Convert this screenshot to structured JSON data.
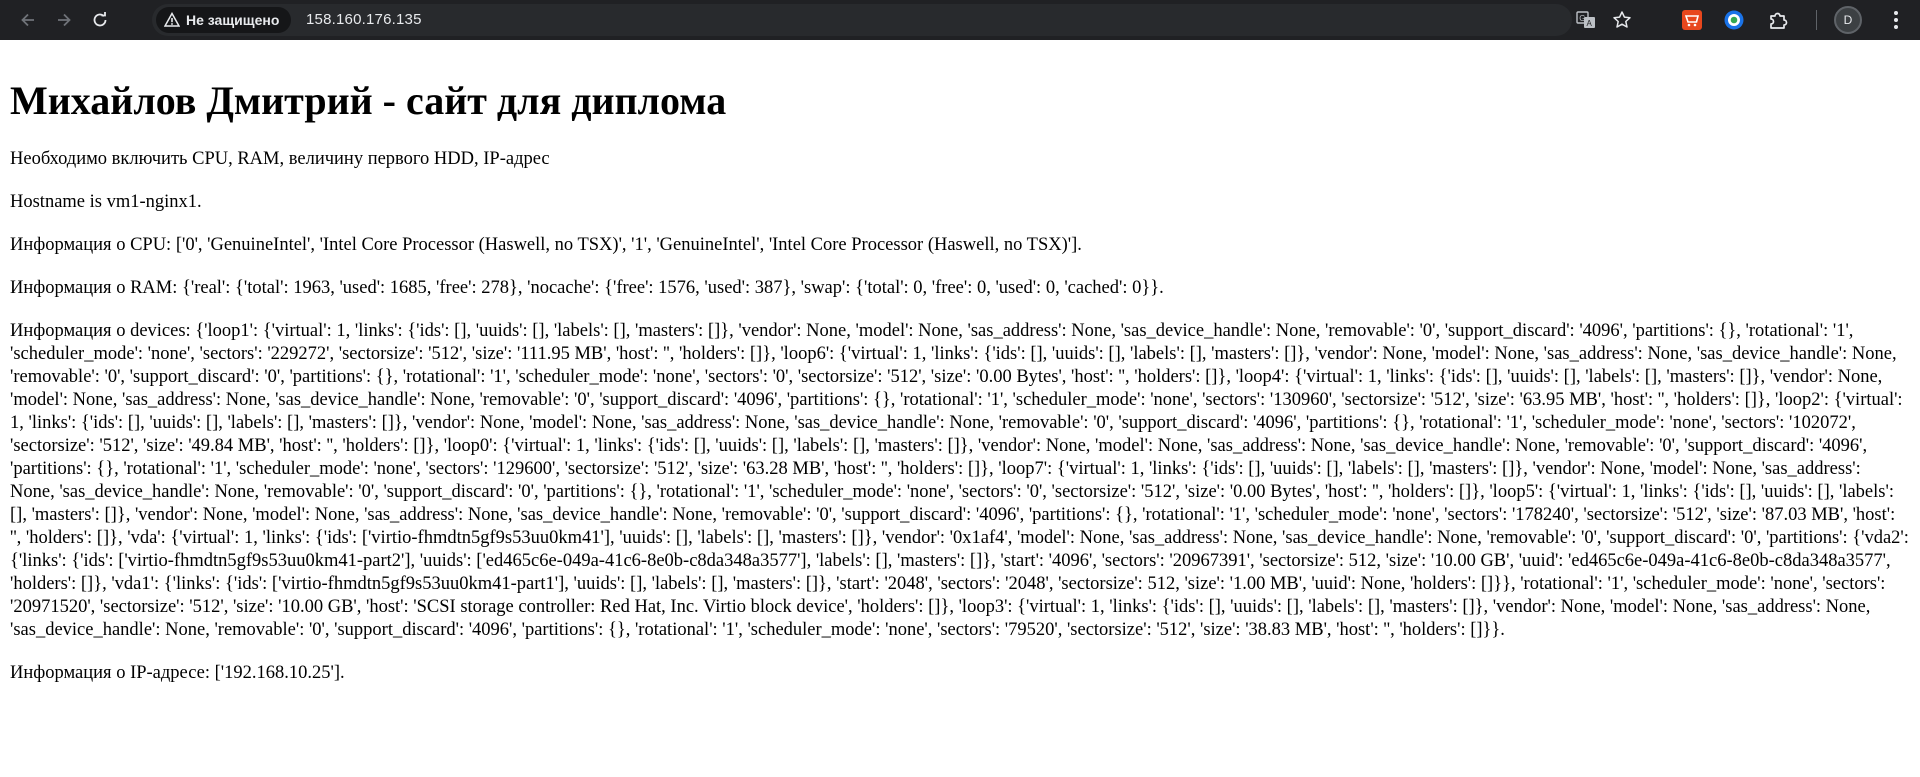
{
  "browser": {
    "security_label": "Не защищено",
    "url": "158.160.176.135",
    "profile_initial": "D",
    "icons": [
      "back-icon",
      "forward-icon",
      "reload-icon",
      "warning-icon",
      "translate-icon",
      "star-icon",
      "extension-icon",
      "puzzle-icon",
      "menu-icon"
    ]
  },
  "page": {
    "title": "Михайлов Дмитрий - сайт для диплома",
    "intro": "Необходимо включить CPU, RAM, величину первого HDD, IP-адрес",
    "hostname": "Hostname is vm1-nginx1.",
    "cpu": "Информация о CPU: ['0', 'GenuineIntel', 'Intel Core Processor (Haswell, no TSX)', '1', 'GenuineIntel', 'Intel Core Processor (Haswell, no TSX)'].",
    "ram": "Информация о RAM: {'real': {'total': 1963, 'used': 1685, 'free': 278}, 'nocache': {'free': 1576, 'used': 387}, 'swap': {'total': 0, 'free': 0, 'used': 0, 'cached': 0}}.",
    "devices": "Информация о devices: {'loop1': {'virtual': 1, 'links': {'ids': [], 'uuids': [], 'labels': [], 'masters': []}, 'vendor': None, 'model': None, 'sas_address': None, 'sas_device_handle': None, 'removable': '0', 'support_discard': '4096', 'partitions': {}, 'rotational': '1', 'scheduler_mode': 'none', 'sectors': '229272', 'sectorsize': '512', 'size': '111.95 MB', 'host': '', 'holders': []}, 'loop6': {'virtual': 1, 'links': {'ids': [], 'uuids': [], 'labels': [], 'masters': []}, 'vendor': None, 'model': None, 'sas_address': None, 'sas_device_handle': None, 'removable': '0', 'support_discard': '0', 'partitions': {}, 'rotational': '1', 'scheduler_mode': 'none', 'sectors': '0', 'sectorsize': '512', 'size': '0.00 Bytes', 'host': '', 'holders': []}, 'loop4': {'virtual': 1, 'links': {'ids': [], 'uuids': [], 'labels': [], 'masters': []}, 'vendor': None, 'model': None, 'sas_address': None, 'sas_device_handle': None, 'removable': '0', 'support_discard': '4096', 'partitions': {}, 'rotational': '1', 'scheduler_mode': 'none', 'sectors': '130960', 'sectorsize': '512', 'size': '63.95 MB', 'host': '', 'holders': []}, 'loop2': {'virtual': 1, 'links': {'ids': [], 'uuids': [], 'labels': [], 'masters': []}, 'vendor': None, 'model': None, 'sas_address': None, 'sas_device_handle': None, 'removable': '0', 'support_discard': '4096', 'partitions': {}, 'rotational': '1', 'scheduler_mode': 'none', 'sectors': '102072', 'sectorsize': '512', 'size': '49.84 MB', 'host': '', 'holders': []}, 'loop0': {'virtual': 1, 'links': {'ids': [], 'uuids': [], 'labels': [], 'masters': []}, 'vendor': None, 'model': None, 'sas_address': None, 'sas_device_handle': None, 'removable': '0', 'support_discard': '4096', 'partitions': {}, 'rotational': '1', 'scheduler_mode': 'none', 'sectors': '129600', 'sectorsize': '512', 'size': '63.28 MB', 'host': '', 'holders': []}, 'loop7': {'virtual': 1, 'links': {'ids': [], 'uuids': [], 'labels': [], 'masters': []}, 'vendor': None, 'model': None, 'sas_address': None, 'sas_device_handle': None, 'removable': '0', 'support_discard': '0', 'partitions': {}, 'rotational': '1', 'scheduler_mode': 'none', 'sectors': '0', 'sectorsize': '512', 'size': '0.00 Bytes', 'host': '', 'holders': []}, 'loop5': {'virtual': 1, 'links': {'ids': [], 'uuids': [], 'labels': [], 'masters': []}, 'vendor': None, 'model': None, 'sas_address': None, 'sas_device_handle': None, 'removable': '0', 'support_discard': '4096', 'partitions': {}, 'rotational': '1', 'scheduler_mode': 'none', 'sectors': '178240', 'sectorsize': '512', 'size': '87.03 MB', 'host': '', 'holders': []}, 'vda': {'virtual': 1, 'links': {'ids': ['virtio-fhmdtn5gf9s53uu0km41'], 'uuids': [], 'labels': [], 'masters': []}, 'vendor': '0x1af4', 'model': None, 'sas_address': None, 'sas_device_handle': None, 'removable': '0', 'support_discard': '0', 'partitions': {'vda2': {'links': {'ids': ['virtio-fhmdtn5gf9s53uu0km41-part2'], 'uuids': ['ed465c6e-049a-41c6-8e0b-c8da348a3577'], 'labels': [], 'masters': []}, 'start': '4096', 'sectors': '20967391', 'sectorsize': 512, 'size': '10.00 GB', 'uuid': 'ed465c6e-049a-41c6-8e0b-c8da348a3577', 'holders': []}, 'vda1': {'links': {'ids': ['virtio-fhmdtn5gf9s53uu0km41-part1'], 'uuids': [], 'labels': [], 'masters': []}, 'start': '2048', 'sectors': '2048', 'sectorsize': 512, 'size': '1.00 MB', 'uuid': None, 'holders': []}}, 'rotational': '1', 'scheduler_mode': 'none', 'sectors': '20971520', 'sectorsize': '512', 'size': '10.00 GB', 'host': 'SCSI storage controller: Red Hat, Inc. Virtio block device', 'holders': []}, 'loop3': {'virtual': 1, 'links': {'ids': [], 'uuids': [], 'labels': [], 'masters': []}, 'vendor': None, 'model': None, 'sas_address': None, 'sas_device_handle': None, 'removable': '0', 'support_discard': '4096', 'partitions': {}, 'rotational': '1', 'scheduler_mode': 'none', 'sectors': '79520', 'sectorsize': '512', 'size': '38.83 MB', 'host': '', 'holders': []}}.",
    "ip": "Информация о IP-адресе: ['192.168.10.25']."
  }
}
